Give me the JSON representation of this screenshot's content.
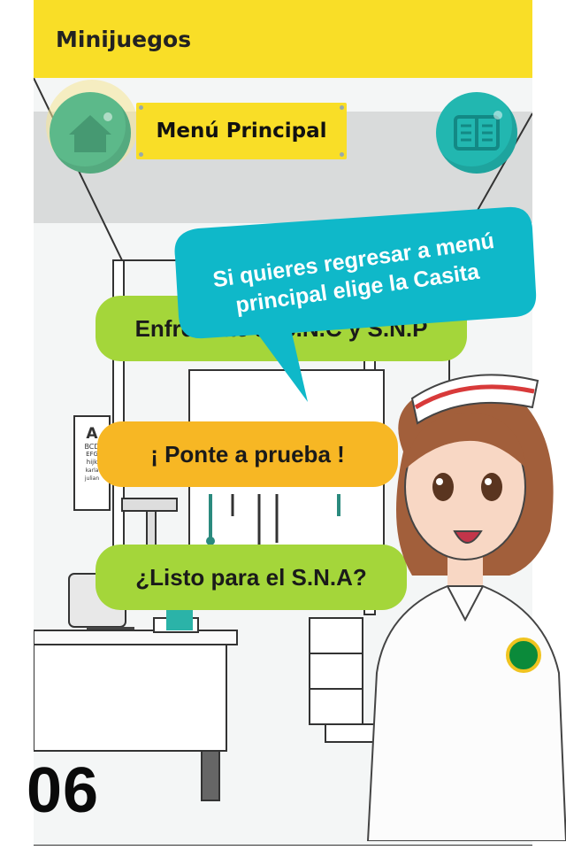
{
  "app_bar": {
    "title": "Minijuegos"
  },
  "header": {
    "menu_label": "Menú Principal"
  },
  "menu": {
    "buttons": [
      {
        "label": "Enfrentate al S.N.C y S.N.P"
      },
      {
        "label": "¡ Ponte a prueba !"
      },
      {
        "label": "¿Listo para el S.N.A?"
      }
    ]
  },
  "speech_bubble": {
    "text": "Si quieres regresar a menú principal elige la Casita"
  },
  "eye_chart": {
    "letters": [
      "A",
      "BCD",
      "EFG",
      "hijk",
      "karla",
      "julian"
    ]
  },
  "page_number": "06",
  "icons": {
    "home": "home-icon",
    "book": "book-icon"
  },
  "colors": {
    "app_bar": "#f9de27",
    "home_button": "#5cb98a",
    "book_button": "#22b7b0",
    "pill_green": "#a4d63a",
    "pill_orange": "#f7b724",
    "bubble": "#0fb8c9"
  }
}
